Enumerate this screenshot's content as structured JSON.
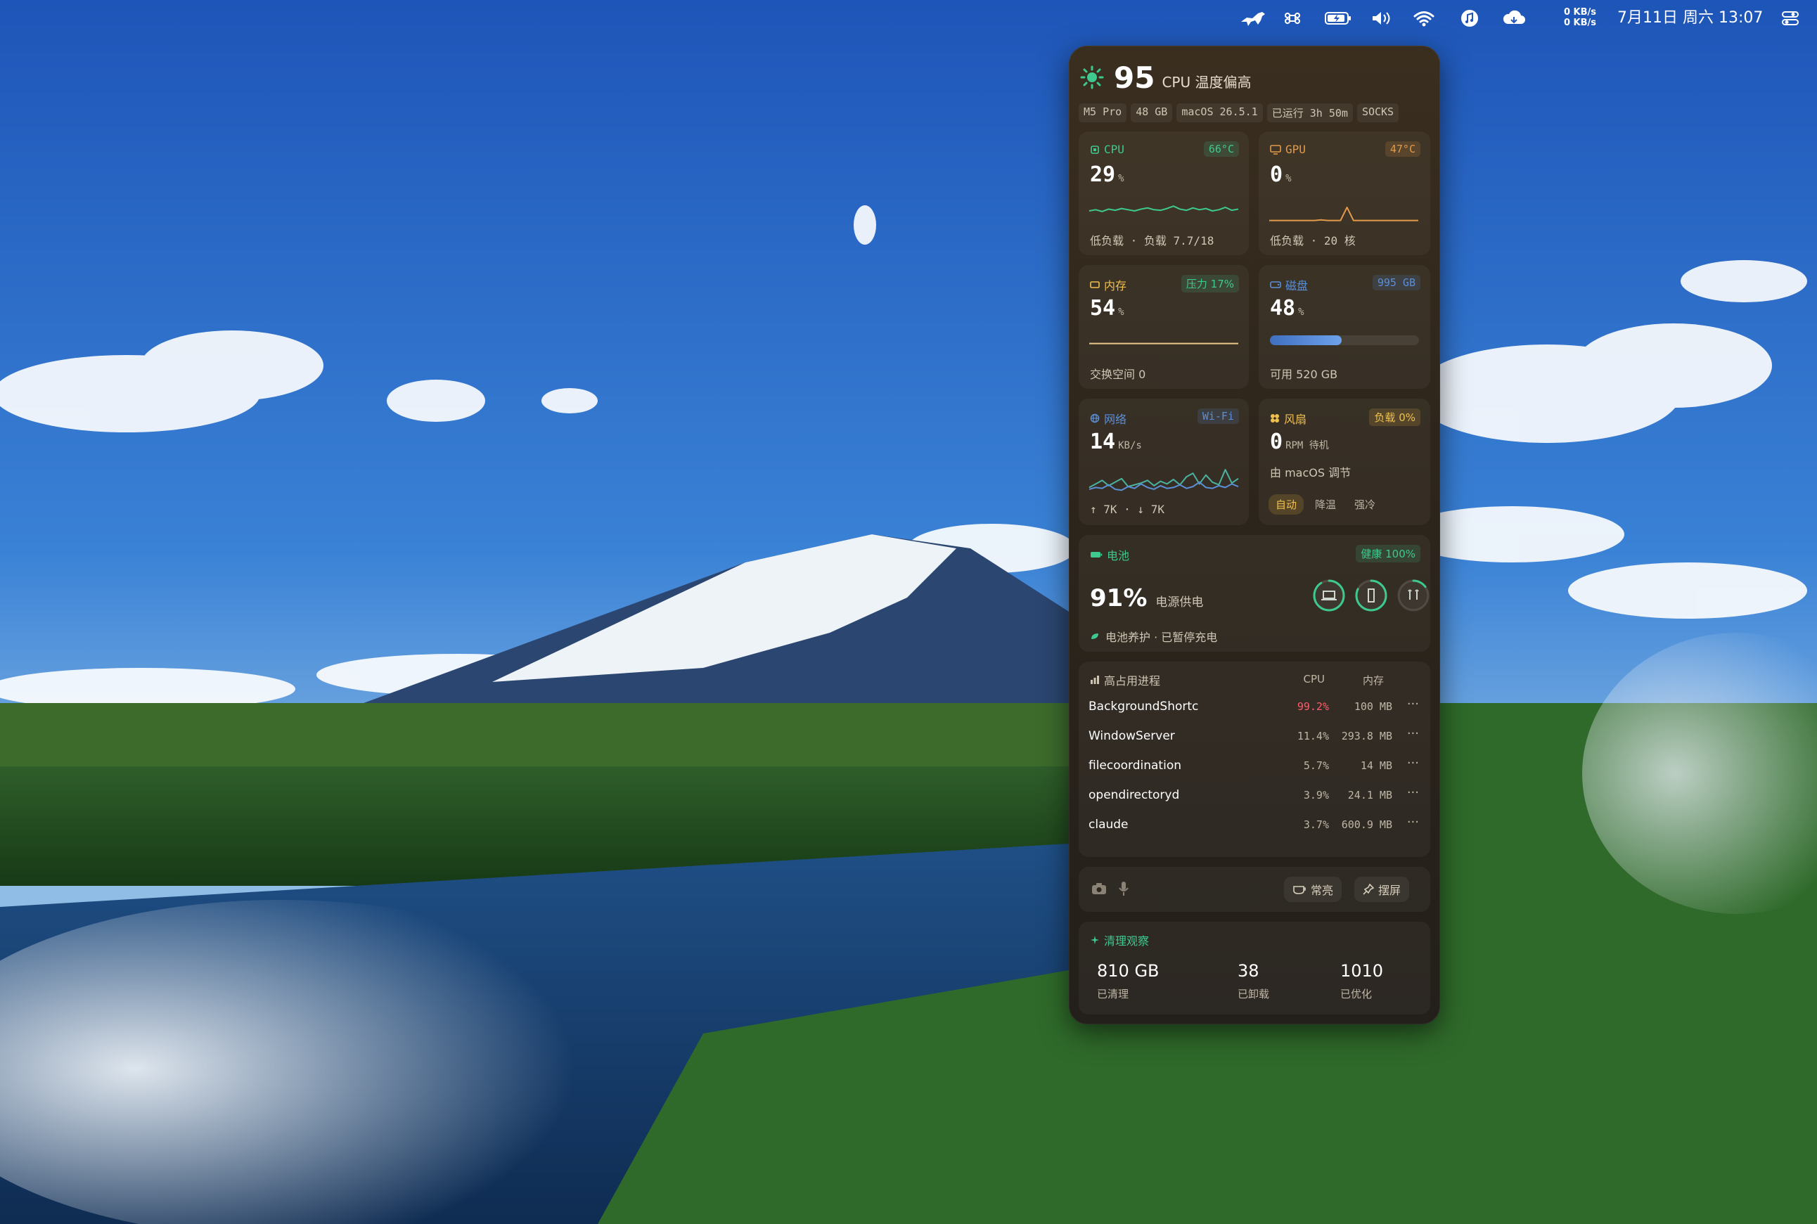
{
  "colors": {
    "accent_green": "#3ec98f",
    "accent_orange": "#e39a4a",
    "accent_blue": "#5a8fd8",
    "accent_yellow": "#f0c04d",
    "danger": "#ff5c6a",
    "panel_bg": "#2e261c"
  },
  "menubar": {
    "icons": [
      "dinosaur-icon",
      "command-icon",
      "battery-icon",
      "volume-icon",
      "wifi-icon",
      "music-icon",
      "cloud-icon",
      "control-center-icon"
    ],
    "net_up": "0 KB/s",
    "net_down": "0 KB/s",
    "clock": "7月11日 周六 13:07"
  },
  "header": {
    "icon": "sun-icon",
    "score": "95",
    "status": "CPU 温度偏高"
  },
  "chips": [
    "M5 Pro",
    "48 GB",
    "macOS 26.5.1",
    "已运行 3h 50m",
    "SOCKS"
  ],
  "cpu": {
    "title": "CPU",
    "badge": "66°C",
    "value": "29",
    "unit": "%",
    "foot": "低负载 · 负载 7.7/18",
    "history": [
      20,
      22,
      19,
      23,
      21,
      24,
      22,
      20,
      23,
      25,
      22,
      21,
      24,
      28,
      23,
      21,
      25,
      22,
      24,
      20,
      22,
      26,
      21,
      23
    ]
  },
  "gpu": {
    "title": "GPU",
    "badge": "47°C",
    "value": "0",
    "unit": "%",
    "foot": "低负载 · 20 核",
    "history": [
      4,
      4,
      4,
      4,
      4,
      4,
      4,
      4,
      5,
      4,
      4,
      4,
      26,
      4,
      4,
      4,
      4,
      4,
      4,
      4,
      4,
      4,
      4,
      4
    ]
  },
  "memory": {
    "title": "内存",
    "badge": "压力 17%",
    "value": "54",
    "unit": "%",
    "foot": "交换空间 0",
    "history": [
      54,
      54,
      54,
      54,
      54,
      54,
      54,
      54,
      54,
      54,
      54,
      54,
      54,
      54,
      54,
      54,
      54,
      54,
      54,
      54,
      54,
      54,
      54,
      54
    ]
  },
  "disk": {
    "title": "磁盘",
    "badge": "995 GB",
    "value": "48",
    "unit": "%",
    "foot": "可用 520 GB",
    "used_fraction": 0.48
  },
  "network": {
    "title": "网络",
    "badge": "Wi-Fi",
    "value": "14",
    "unit": "KB/s",
    "foot": "↑ 7K · ↓ 7K",
    "up": [
      6,
      10,
      14,
      8,
      12,
      16,
      7,
      9,
      11,
      14,
      8,
      13,
      10,
      15,
      9,
      18,
      22,
      10,
      20,
      12,
      9,
      26,
      11,
      16
    ],
    "down": [
      4,
      6,
      5,
      9,
      4,
      3,
      7,
      5,
      10,
      6,
      4,
      8,
      5,
      6,
      9,
      5,
      7,
      12,
      6,
      5,
      8,
      6,
      10,
      7
    ]
  },
  "fan": {
    "title": "风扇",
    "badge": "负载 0%",
    "value": "0",
    "unit": "RPM 待机",
    "sub": "由 macOS 调节",
    "modes": [
      {
        "label": "自动",
        "active": true
      },
      {
        "label": "降温",
        "active": false
      },
      {
        "label": "强冷",
        "active": false
      }
    ]
  },
  "battery": {
    "title": "电池",
    "badge": "健康 100%",
    "value": "91%",
    "source": "电源供电",
    "foot": "电池养护 · 已暂停充电",
    "devices": [
      {
        "icon": "laptop-icon",
        "level": 0.91,
        "color": "#3ec98f"
      },
      {
        "icon": "phone-icon",
        "level": 0.82,
        "color": "#3ec98f"
      },
      {
        "icon": "airpods-icon",
        "level": 0.15,
        "color": "#3ec98f"
      }
    ]
  },
  "processes": {
    "title": "高占用进程",
    "col_cpu": "CPU",
    "col_mem": "内存",
    "rows": [
      {
        "name": "BackgroundShortc",
        "cpu": "99.2%",
        "mem": "100 MB",
        "hot": true
      },
      {
        "name": "WindowServer",
        "cpu": "11.4%",
        "mem": "293.8 MB",
        "hot": false
      },
      {
        "name": "filecoordination",
        "cpu": "5.7%",
        "mem": "14 MB",
        "hot": false
      },
      {
        "name": "opendirectoryd",
        "cpu": "3.9%",
        "mem": "24.1 MB",
        "hot": false
      },
      {
        "name": "claude",
        "cpu": "3.7%",
        "mem": "600.9 MB",
        "hot": false
      }
    ],
    "more": "···"
  },
  "toolbar": {
    "keep_awake": "常亮",
    "pin": "摆屏"
  },
  "cleanup": {
    "title": "清理观察",
    "stats": [
      {
        "value": "810 GB",
        "label": "已清理"
      },
      {
        "value": "38",
        "label": "已卸载"
      },
      {
        "value": "1010",
        "label": "已优化"
      }
    ]
  }
}
